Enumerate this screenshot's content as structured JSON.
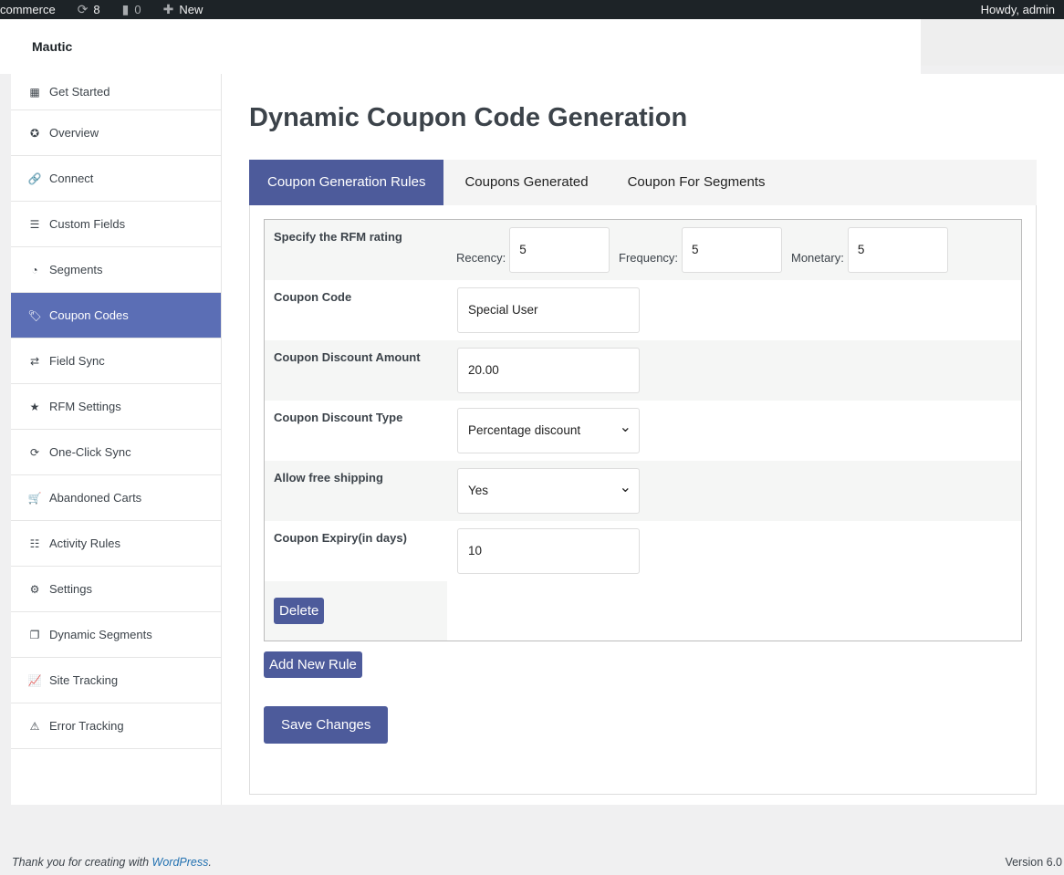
{
  "adminbar": {
    "site": "commerce",
    "updates": "8",
    "comments": "0",
    "new": "New",
    "howdy": "Howdy, admin"
  },
  "brand": "Mautic",
  "sidebar": {
    "items": [
      {
        "label": "Get Started",
        "icon": "grid-icon",
        "glyph": "▦"
      },
      {
        "label": "Overview",
        "icon": "overview-icon",
        "glyph": "✪"
      },
      {
        "label": "Connect",
        "icon": "link-icon",
        "glyph": "🔗"
      },
      {
        "label": "Custom Fields",
        "icon": "list-icon",
        "glyph": "☰"
      },
      {
        "label": "Segments",
        "icon": "pie-chart-icon",
        "glyph": "◔"
      },
      {
        "label": "Coupon Codes",
        "icon": "tags-icon",
        "glyph": "🏷"
      },
      {
        "label": "Field Sync",
        "icon": "exchange-icon",
        "glyph": "⇄"
      },
      {
        "label": "RFM Settings",
        "icon": "star-icon",
        "glyph": "★"
      },
      {
        "label": "One-Click Sync",
        "icon": "refresh-icon",
        "glyph": "⟳"
      },
      {
        "label": "Abandoned Carts",
        "icon": "cart-icon",
        "glyph": "🛒"
      },
      {
        "label": "Activity Rules",
        "icon": "tasks-icon",
        "glyph": "☷"
      },
      {
        "label": "Settings",
        "icon": "gears-icon",
        "glyph": "⚙"
      },
      {
        "label": "Dynamic Segments",
        "icon": "clone-icon",
        "glyph": "❐"
      },
      {
        "label": "Site Tracking",
        "icon": "line-chart-icon",
        "glyph": "📈"
      },
      {
        "label": "Error Tracking",
        "icon": "warning-icon",
        "glyph": "⚠"
      }
    ],
    "active": 5
  },
  "page": {
    "title": "Dynamic Coupon Code Generation",
    "tabs": [
      "Coupon Generation Rules",
      "Coupons Generated",
      "Coupon For Segments"
    ],
    "rule": {
      "rfm_label": "Specify the RFM rating",
      "recency_label": "Recency:",
      "recency": "5",
      "frequency_label": "Frequency:",
      "frequency": "5",
      "monetary_label": "Monetary:",
      "monetary": "5",
      "code_label": "Coupon Code",
      "code": "Special User",
      "amount_label": "Coupon Discount Amount",
      "amount": "20.00",
      "type_label": "Coupon Discount Type",
      "type": "Percentage discount",
      "shipping_label": "Allow free shipping",
      "shipping": "Yes",
      "expiry_label": "Coupon Expiry(in days)",
      "expiry": "10",
      "delete": "Delete"
    },
    "add_rule": "Add New Rule",
    "save": "Save Changes"
  },
  "footer": {
    "thanks": "Thank you for creating with ",
    "wp": "WordPress",
    "dot": ".",
    "version": "Version 6.0"
  },
  "colors": {
    "accent": "#4d5b9b",
    "active_nav": "#5b6eb5"
  }
}
